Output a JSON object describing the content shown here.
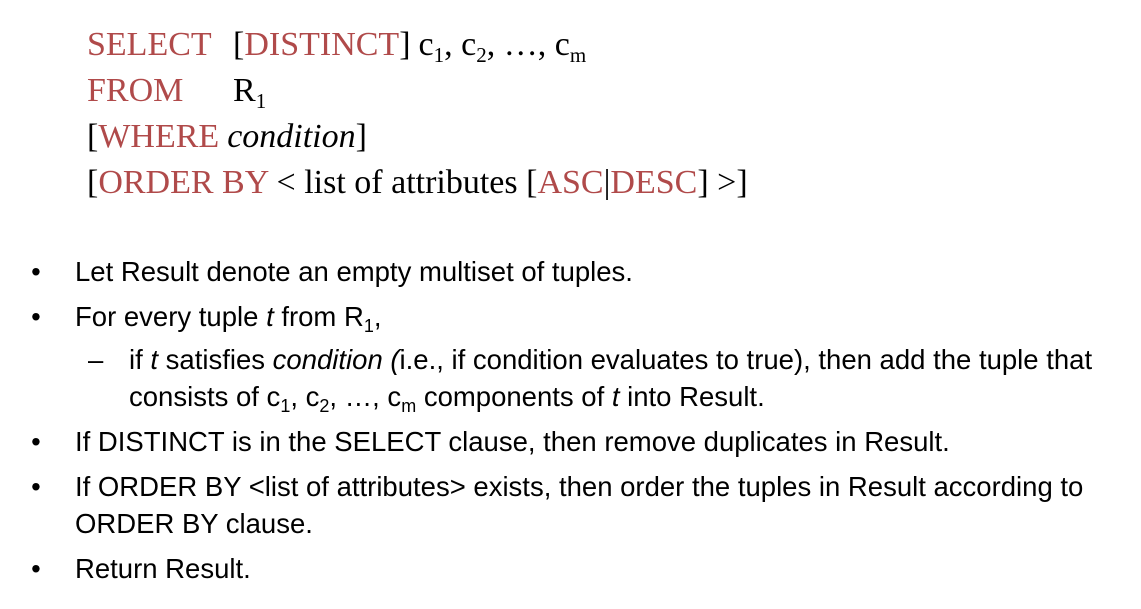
{
  "syntax": {
    "select_kw": "SELECT",
    "distinct_open": "[",
    "distinct_kw": "DISTINCT",
    "distinct_close": "]",
    "c_prefix": "c",
    "c1_sub": "1",
    "sep1": ", ",
    "c2_sub": "2",
    "ellipsis": ", …, ",
    "cm_sub": "m",
    "from_kw": "FROM",
    "relation": "R",
    "relation_sub": "1",
    "where_open": "[",
    "where_kw": "WHERE",
    "where_cond": "condition",
    "where_close": "]",
    "order_open": "[",
    "order_kw": "ORDER BY",
    "order_mid": " < list of attributes ",
    "sort_open": "[",
    "asc_kw": "ASC",
    "pipe": "|",
    "desc_kw": "DESC",
    "sort_close": "]",
    "order_close": " >]"
  },
  "bullets": {
    "marker": "•",
    "dash": "–",
    "b1": "Let Result denote an empty multiset of tuples.",
    "b2_pre": "For every tuple ",
    "b2_t": "t",
    "b2_mid": " from R",
    "b2_sub": "1",
    "b2_post": ",",
    "s1_pre": "if ",
    "s1_t": "t",
    "s1_mid": " satisfies ",
    "s1_cond": "condition (",
    "s1_post": "i.e., if condition evaluates to true), then add the tuple that consists of c",
    "s1_sub1": "1",
    "s1_c2": ", c",
    "s1_sub2": "2",
    "s1_cm": ", …, c",
    "s1_subm": "m",
    "s1_comp": " components of ",
    "s1_t2": "t",
    "s1_end": " into Result.",
    "b3": "If DISTINCT is in the SELECT clause, then remove duplicates in Result.",
    "b4": "If ORDER BY <list of attributes> exists, then order the tuples in Result according to ORDER BY clause.",
    "b5": "Return Result."
  },
  "colors": {
    "keyword": "#b04a4a",
    "text": "#000000",
    "background": "#ffffff"
  }
}
